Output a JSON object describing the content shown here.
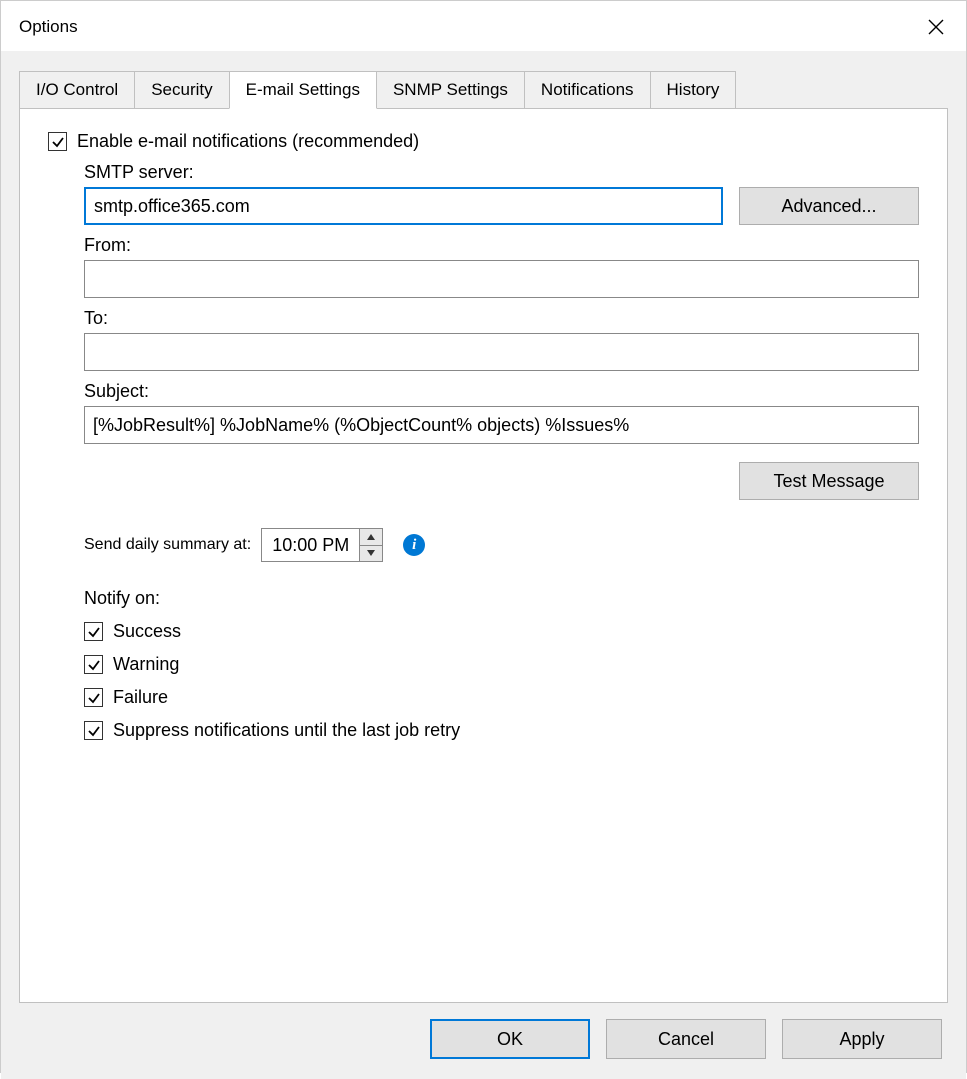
{
  "window": {
    "title": "Options"
  },
  "tabs": {
    "items": [
      "I/O Control",
      "Security",
      "E-mail Settings",
      "SNMP Settings",
      "Notifications",
      "History"
    ],
    "activeIndex": 2
  },
  "email": {
    "enable_label": "Enable e-mail notifications (recommended)",
    "enable_checked": true,
    "smtp_label": "SMTP server:",
    "smtp_value": "smtp.office365.com",
    "advanced_label": "Advanced...",
    "from_label": "From:",
    "from_value": "",
    "to_label": "To:",
    "to_value": "",
    "subject_label": "Subject:",
    "subject_value": "[%JobResult%] %JobName% (%ObjectCount% objects) %Issues%",
    "test_label": "Test Message",
    "summary_label": "Send daily summary at:",
    "summary_time": "10:00 PM",
    "notify_label": "Notify on:",
    "notify_items": [
      {
        "label": "Success",
        "checked": true
      },
      {
        "label": "Warning",
        "checked": true
      },
      {
        "label": "Failure",
        "checked": true
      },
      {
        "label": "Suppress notifications until the last job retry",
        "checked": true
      }
    ]
  },
  "footer": {
    "ok": "OK",
    "cancel": "Cancel",
    "apply": "Apply"
  }
}
